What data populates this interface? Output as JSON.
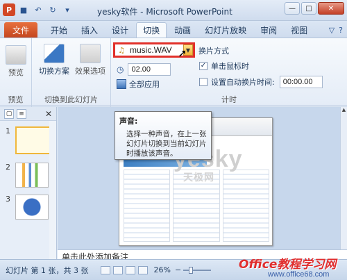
{
  "window": {
    "title": "yesky软件 - Microsoft PowerPoint",
    "app_icon": "P",
    "min": "—",
    "max": "□",
    "close": "✕"
  },
  "quick_access": {
    "save": "■",
    "undo": "↶",
    "redo": "↻",
    "more": "▾"
  },
  "tabs": [
    "文件",
    "开始",
    "插入",
    "设计",
    "切换",
    "动画",
    "幻灯片放映",
    "审阅",
    "视图"
  ],
  "active_tab": "切换",
  "tab_right": {
    "minimize_ribbon": "▽",
    "help": "?"
  },
  "ribbon": {
    "preview_group": {
      "preview_label": "预览",
      "group_label": "预览"
    },
    "transition_group": {
      "scheme_label": "切换方案",
      "effect_label": "效果选项",
      "group_label": "切换到此幻灯片"
    },
    "timing_group": {
      "sound_value": "music.WAV",
      "duration_value": "02.00",
      "apply_all": "全部应用",
      "switch_mode": "换片方式",
      "on_click": "单击鼠标时",
      "on_click_checked": true,
      "auto_after": "设置自动换片时间:",
      "auto_after_checked": false,
      "auto_time": "00:00.00",
      "group_label": "计时"
    }
  },
  "tooltip": {
    "title": "声音:",
    "body": "选择一种声音，在上一张幻灯片切换到当前幻灯片时播放该声音。"
  },
  "slides_pane": {
    "close": "✕",
    "thumbnails": [
      "1",
      "2",
      "3"
    ]
  },
  "slide": {
    "logo_text": "yesky",
    "logo_sub": "天极网"
  },
  "notes_text": "单击此处添加备注",
  "status": {
    "slide_info": "幻灯片 第 1 张，共 3 张",
    "zoom": "26%",
    "minus": "−"
  },
  "watermark": {
    "line1": "Office教程学习网",
    "line2": "www.office68.com"
  }
}
